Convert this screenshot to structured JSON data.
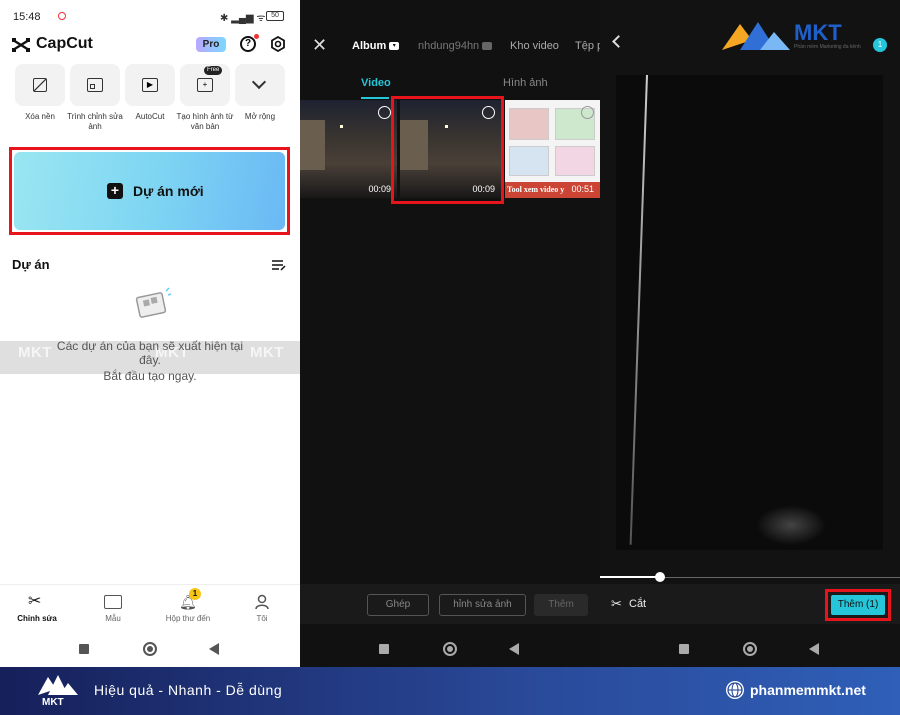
{
  "panel1": {
    "status_time": "15:48",
    "battery": "50",
    "app_name": "CapCut",
    "pro_badge": "Pro",
    "tools": [
      {
        "label": "Xóa nền"
      },
      {
        "label": "Trình chỉnh sửa ảnh"
      },
      {
        "label": "AutoCut"
      },
      {
        "label": "Tạo hình ảnh từ văn bản",
        "badge": "Free"
      },
      {
        "label": "Mở rộng"
      }
    ],
    "new_project": "Dự án mới",
    "projects_title": "Dự án",
    "empty_text_1": "Các dự án của bạn sẽ xuất hiện tại đây.",
    "empty_text_2": "Bắt đầu tạo ngay.",
    "nav": [
      {
        "label": "Chỉnh sửa"
      },
      {
        "label": "Mẫu"
      },
      {
        "label": "Hộp thư đến",
        "badge": "1"
      },
      {
        "label": "Tôi"
      }
    ],
    "watermark": "MKT"
  },
  "panel2": {
    "tabs": [
      "Album",
      "nhdung94hn",
      "Kho video",
      "Tệp p"
    ],
    "subtabs": [
      "Video",
      "Hình ảnh"
    ],
    "videos": [
      {
        "duration": "00:09"
      },
      {
        "duration": "00:09"
      },
      {
        "duration": "00:51",
        "caption": "Tool xem video y"
      }
    ],
    "buttons": [
      "Ghép",
      "hỉnh sửa ảnh",
      "Thêm"
    ]
  },
  "panel3": {
    "brand": "MKT",
    "brand_tagline": "Phần mềm Marketing đa kênh",
    "count_badge": "1",
    "cut_label": "Cắt",
    "add_button": "Thêm (1)",
    "progress_fraction": 0.2
  },
  "banner": {
    "logo": "MKT",
    "slogan": "Hiệu quả - Nhanh - Dễ dùng",
    "website": "phanmemmkt.net"
  },
  "colors": {
    "accent_cyan": "#26c6da",
    "highlight_red": "#e8141c",
    "banner_blue": "#1e3a8a"
  }
}
